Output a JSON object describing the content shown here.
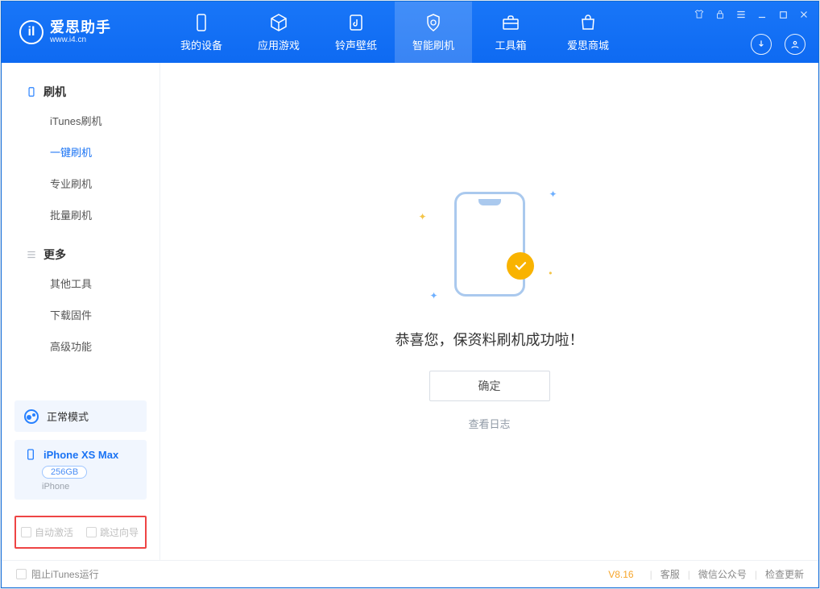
{
  "brand": {
    "title": "爱思助手",
    "url": "www.i4.cn"
  },
  "tabs": {
    "device": "我的设备",
    "apps": "应用游戏",
    "ringtone": "铃声壁纸",
    "flash": "智能刷机",
    "toolbox": "工具箱",
    "store": "爱思商城"
  },
  "sidebar": {
    "section_flash": "刷机",
    "itunes_flash": "iTunes刷机",
    "oneclick_flash": "一键刷机",
    "pro_flash": "专业刷机",
    "batch_flash": "批量刷机",
    "section_more": "更多",
    "other_tools": "其他工具",
    "download_fw": "下载固件",
    "adv_features": "高级功能"
  },
  "mode": {
    "label": "正常模式"
  },
  "device": {
    "name": "iPhone XS Max",
    "capacity": "256GB",
    "type": "iPhone"
  },
  "checks": {
    "auto_activate": "自动激活",
    "skip_guide": "跳过向导"
  },
  "main": {
    "success": "恭喜您，保资料刷机成功啦！",
    "ok": "确定",
    "view_log": "查看日志"
  },
  "statusbar": {
    "block_itunes": "阻止iTunes运行",
    "version": "V8.16",
    "support": "客服",
    "wechat": "微信公众号",
    "check_update": "检查更新"
  }
}
